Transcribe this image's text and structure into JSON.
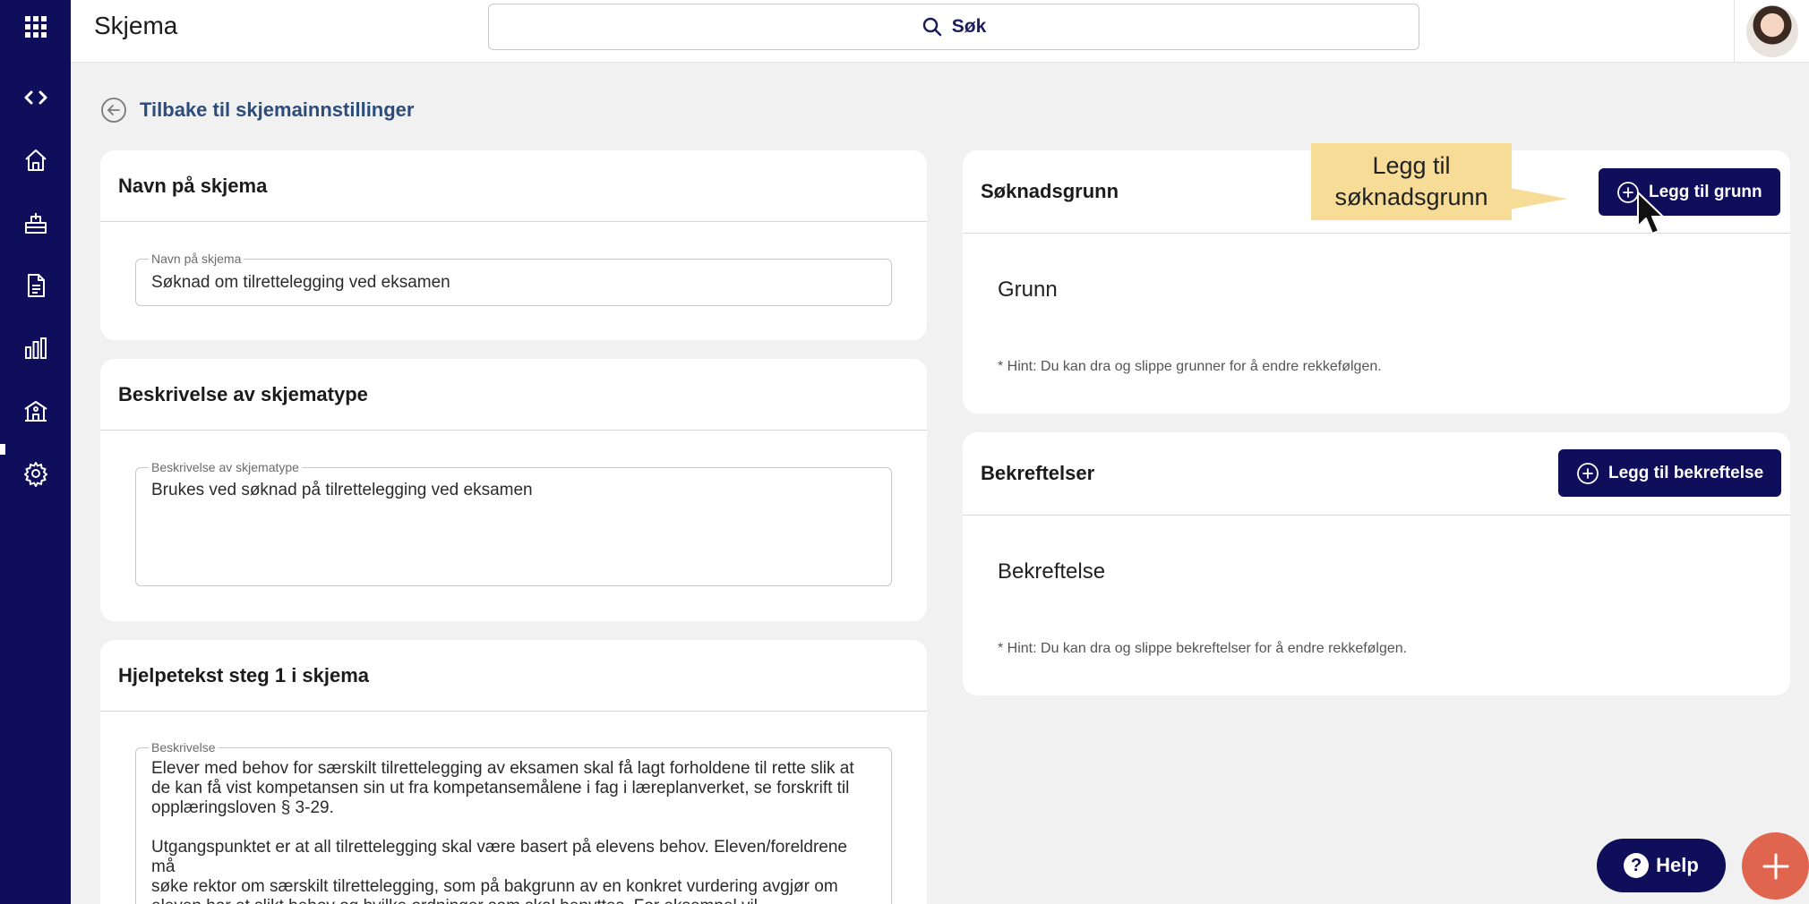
{
  "header": {
    "app_title": "Skjema",
    "search_label": "Søk"
  },
  "back_link": "Tilbake til skjemainnstillinger",
  "name_card": {
    "title": "Navn på skjema",
    "field_label": "Navn på skjema",
    "field_value": "Søknad om tilrettelegging ved eksamen"
  },
  "description_card": {
    "title": "Beskrivelse av skjematype",
    "field_label": "Beskrivelse av skjematype",
    "field_value": "Brukes ved søknad på tilrettelegging ved eksamen"
  },
  "help_card": {
    "title": "Hjelpetekst steg 1 i skjema",
    "field_label": "Beskrivelse",
    "field_value": "Elever med behov for særskilt tilrettelegging av eksamen skal få lagt forholdene til rette slik at\nde kan få vist kompetansen sin ut fra kompetansemålene i fag i læreplanverket, se forskrift til\nopplæringsloven § 3-29.\n\nUtgangspunktet er at all tilrettelegging skal være basert på elevens behov. Eleven/foreldrene må\nsøke rektor om særskilt tilrettelegging, som på bakgrunn av en konkret vurdering avgjør om\neleven har et slikt behov og hvilke ordninger som skal benyttes. For eksempel vil\nforlenget tid være et vanlig tiltak ved behov for tilrettelegging. Dokumentasjon kan"
  },
  "reasons_card": {
    "title": "Søknadsgrunn",
    "add_button": "Legg til grunn",
    "section_heading": "Grunn",
    "hint": "* Hint: Du kan dra og slippe grunner for å endre rekkefølgen."
  },
  "confirmations_card": {
    "title": "Bekreftelser",
    "add_button": "Legg til bekreftelse",
    "section_heading": "Bekreftelse",
    "hint": "* Hint: Du kan dra og slippe bekreftelser for å endre rekkefølgen."
  },
  "callout": {
    "line1": "Legg til",
    "line2": "søknadsgrunn"
  },
  "help_button": "Help",
  "colors": {
    "navy": "#0f0e5a",
    "link": "#2c4d7b",
    "callout": "#f6dc97",
    "fab": "#e0654f"
  }
}
